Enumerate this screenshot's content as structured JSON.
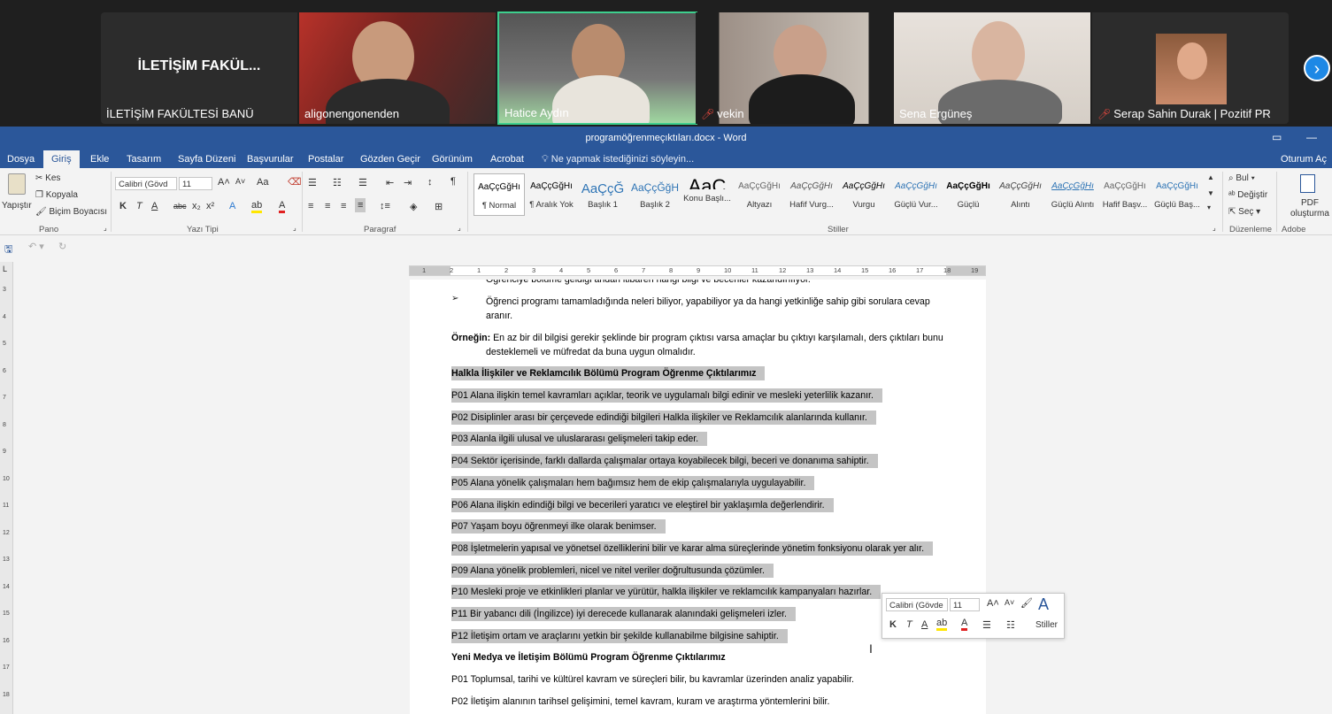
{
  "meeting": {
    "participants": [
      {
        "name": "İLETİŞİM FAKÜLTESİ BANÜ",
        "tile_label": "İLETİŞİM FAKÜL...",
        "muted": false
      },
      {
        "name": "aligonengonenden",
        "muted": false
      },
      {
        "name": "Hatice Aydın",
        "muted": false,
        "active_speaker": true
      },
      {
        "name": "vekin",
        "muted": true
      },
      {
        "name": "Sena Ergüneş",
        "muted": false
      },
      {
        "name": "Serap Sahin Durak | Pozitif PR",
        "muted": true
      }
    ],
    "next_icon": "chevron-right-icon",
    "active_speaker_color": "#3ecf8e"
  },
  "word": {
    "title": "programöğrenmeçıktıları.docx - Word",
    "signin": "Oturum Aç",
    "tabs": [
      "Dosya",
      "Giriş",
      "Ekle",
      "Tasarım",
      "Sayfa Düzeni",
      "Başvurular",
      "Postalar",
      "Gözden Geçir",
      "Görünüm",
      "Acrobat"
    ],
    "active_tab": "Giriş",
    "tell_me": "Ne yapmak istediğinizi söyleyin...",
    "accent": "#2b579a"
  },
  "ribbon": {
    "clipboard": {
      "paste": "Yapıştır",
      "cut": "Kes",
      "copy": "Kopyala",
      "format_painter": "Biçim Boyacısı",
      "label": "Pano"
    },
    "font": {
      "name": "Calibri (Gövd",
      "size": "11",
      "label": "Yazı Tipi",
      "case": "Aa",
      "bold": "K",
      "italic": "T",
      "underline": "A",
      "strike": "abc",
      "sub": "x₂",
      "sup": "x²"
    },
    "paragraph": {
      "label": "Paragraf"
    },
    "styles": {
      "label": "Stiller",
      "items": [
        {
          "preview": "AaÇçĞğHı",
          "name": "¶ Normal",
          "selected": true
        },
        {
          "preview": "AaÇçĞğHı",
          "name": "¶ Aralık Yok"
        },
        {
          "preview": "AaÇçĞ",
          "name": "Başlık 1"
        },
        {
          "preview": "AaÇçĞğH",
          "name": "Başlık 2"
        },
        {
          "preview": "AaÇ",
          "name": "Konu Başlı..."
        },
        {
          "preview": "AaÇçĞğHı",
          "name": "Altyazı"
        },
        {
          "preview": "AaÇçĞğHı",
          "name": "Hafif Vurg..."
        },
        {
          "preview": "AaÇçĞğHı",
          "name": "Vurgu"
        },
        {
          "preview": "AaÇçĞğHı",
          "name": "Güçlü Vur..."
        },
        {
          "preview": "AaÇçĞğHı",
          "name": "Güçlü"
        },
        {
          "preview": "AaÇçĞğHı",
          "name": "Alıntı"
        },
        {
          "preview": "AaÇçĞğHı",
          "name": "Güçlü Alıntı"
        },
        {
          "preview": "AaÇçĞğHı",
          "name": "Hafif Başv..."
        },
        {
          "preview": "AaÇçĞğHı",
          "name": "Güçlü Baş..."
        }
      ]
    },
    "editing": {
      "find": "Bul",
      "replace": "Değiştir",
      "select": "Seç",
      "label": "Düzenleme"
    },
    "acrobat": {
      "create": "PDF oluşturma",
      "label": "Adobe Acrobat"
    }
  },
  "document": {
    "bullets": [
      "Öğrenciye bölüme geldiği andan itibaren hangi bilgi ve beceriler kazandırılıyor.",
      "Öğrenci programı tamamladığında neleri biliyor, yapabiliyor ya da hangi yetkinliğe sahip gibi sorulara cevap",
      "aranır."
    ],
    "example_label": "Örneğin:",
    "example_line1": "En az bir dil bilgisi gerekir şeklinde bir program çıktısı varsa amaçlar bu çıktıyı karşılamalı, ders çıktıları bunu",
    "example_line2": "desteklemeli ve müfredat da buna uygun olmalıdır.",
    "heading1": "Halkla İlişkiler ve Reklamcılık Bölümü Program Öğrenme Çıktılarımız",
    "outcomes1": [
      "P01 Alana ilişkin temel kavramları açıklar, teorik ve uygulamalı bilgi edinir ve mesleki yeterlilik kazanır.",
      "P02 Disiplinler arası bir çerçevede edindiği bilgileri Halkla ilişkiler ve Reklamcılık alanlarında kullanır.",
      "P03 Alanla ilgili ulusal ve uluslararası gelişmeleri takip eder.",
      "P04 Sektör içerisinde, farklı dallarda çalışmalar ortaya koyabilecek bilgi, beceri ve donanıma sahiptir.",
      "P05 Alana yönelik çalışmaları hem bağımsız hem de ekip çalışmalarıyla uygulayabilir.",
      "P06 Alana ilişkin edindiği bilgi ve becerileri yaratıcı ve eleştirel bir yaklaşımla değerlendirir.",
      "P07 Yaşam boyu öğrenmeyi ilke olarak benimser.",
      "P08 İşletmelerin yapısal ve yönetsel özelliklerini bilir ve karar alma süreçlerinde yönetim fonksiyonu olarak yer alır.",
      "P09 Alana yönelik problemleri, nicel ve nitel veriler doğrultusunda çözümler.",
      "P10 Mesleki proje ve etkinlikleri planlar ve yürütür, halkla ilişkiler ve reklamcılık kampanyaları hazırlar.",
      "P11 Bir yabancı dili (İngilizce) iyi derecede kullanarak alanındaki gelişmeleri izler.",
      "P12 İletişim ortam ve araçlarını yetkin bir şekilde kullanabilme bilgisine sahiptir."
    ],
    "heading2": "Yeni Medya ve İletişim Bölümü Program Öğrenme Çıktılarımız",
    "outcomes2": [
      "P01 Toplumsal, tarihi ve kültürel kavram ve süreçleri bilir, bu kavramlar üzerinden analiz yapabilir.",
      "P02 İletişim alanının tarihsel gelişimini, temel kavram, kuram ve araştırma yöntemlerini bilir."
    ]
  },
  "mini_toolbar": {
    "font": "Calibri (Gövde",
    "size": "11",
    "styles": "Stiller",
    "bold": "K",
    "italic": "T",
    "underline": "A"
  },
  "ruler": {
    "h_ticks": [
      "1",
      "2",
      "1",
      "2",
      "3",
      "4",
      "5",
      "6",
      "7",
      "8",
      "9",
      "10",
      "11",
      "12",
      "13",
      "14",
      "15",
      "16",
      "17",
      "18",
      "19"
    ],
    "v_ticks": [
      "3",
      "4",
      "5",
      "6",
      "7",
      "8",
      "9",
      "10",
      "11",
      "12",
      "13",
      "14",
      "15",
      "16",
      "17",
      "18"
    ]
  }
}
